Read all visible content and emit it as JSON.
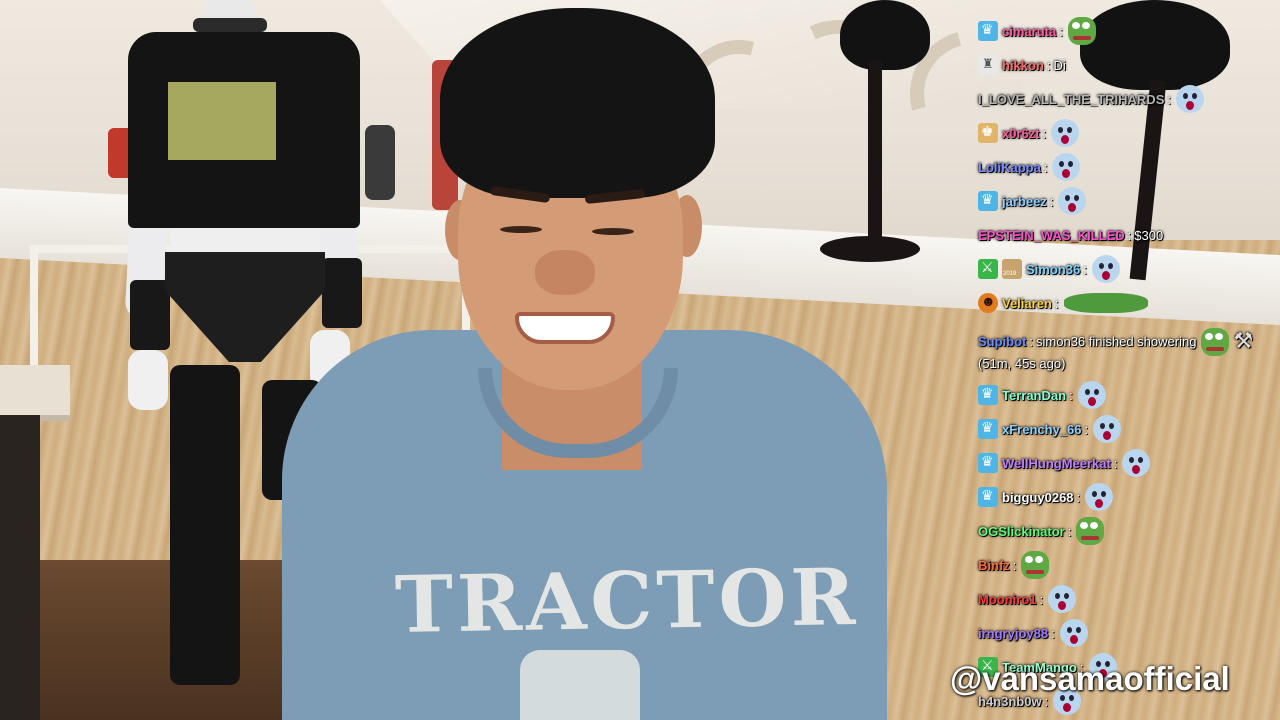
{
  "stream": {
    "watermark": "@vansamaofficial",
    "shirt_text": "TRACTOR"
  },
  "chat": {
    "messages": [
      {
        "user": "cimaruta",
        "color": "#ff5fa2",
        "badges": [
          "sub"
        ],
        "text": "",
        "emotes": [
          "pepe"
        ]
      },
      {
        "user": "hikkon",
        "color": "#ff6b6b",
        "badges": [
          "prime"
        ],
        "text": "Di",
        "emotes": []
      },
      {
        "user": "I_LOVE_ALL_THE_TRIHARDS",
        "color": "#b5b5b5",
        "badges": [],
        "text": "",
        "emotes": [
          "wow"
        ]
      },
      {
        "user": "x0r6zt",
        "color": "#ff5fa2",
        "badges": [
          "gift"
        ],
        "text": "",
        "emotes": [
          "wow"
        ]
      },
      {
        "user": "LoliKappa",
        "color": "#7b8cff",
        "badges": [],
        "text": "",
        "emotes": [
          "wow"
        ]
      },
      {
        "user": "jarbeez",
        "color": "#8fd0ff",
        "badges": [
          "sub"
        ],
        "text": "",
        "emotes": [
          "wow"
        ]
      },
      {
        "user": "EPSTEIN_WAS_KILLED",
        "color": "#ff4fcf",
        "badges": [],
        "text": "$300",
        "emotes": [
          "face"
        ]
      },
      {
        "user": "Simon36",
        "color": "#7fd4ff",
        "badges": [
          "green",
          "year"
        ],
        "text": "",
        "emotes": [
          "wow"
        ]
      },
      {
        "user": "Veliaren",
        "color": "#ffd23f",
        "badges": [
          "orange"
        ],
        "text": "",
        "emotes": [
          "wide"
        ]
      },
      {
        "user": "Supibot",
        "color": "#6b8bff",
        "badges": [],
        "text": "simon36 finished showering",
        "text2": "(51m, 45s ago)",
        "emotes": [
          "pepe",
          "tool"
        ]
      },
      {
        "user": "TerranDan",
        "color": "#7fffd4",
        "badges": [
          "sub"
        ],
        "text": "",
        "emotes": [
          "wow"
        ]
      },
      {
        "user": "xFrenchy_66",
        "color": "#8fd0ff",
        "badges": [
          "sub"
        ],
        "text": "",
        "emotes": [
          "wow"
        ]
      },
      {
        "user": "WellHungMeerkat",
        "color": "#c080ff",
        "badges": [
          "sub"
        ],
        "text": "",
        "emotes": [
          "wow"
        ]
      },
      {
        "user": "bigguy0268",
        "color": "#ffffff",
        "badges": [
          "sub"
        ],
        "text": "",
        "emotes": [
          "wow"
        ]
      },
      {
        "user": "OGSlickinator",
        "color": "#5cff7a",
        "badges": [],
        "text": "",
        "emotes": [
          "pepe"
        ]
      },
      {
        "user": "Binfz",
        "color": "#ff6b3a",
        "badges": [],
        "text": "",
        "emotes": [
          "pepe"
        ]
      },
      {
        "user": "Mooniro1",
        "color": "#ff3a3a",
        "badges": [],
        "text": "",
        "emotes": [
          "wow"
        ]
      },
      {
        "user": "irngryjoy88",
        "color": "#a07bff",
        "badges": [],
        "text": "",
        "emotes": [
          "wow"
        ]
      },
      {
        "user": "TeamMango",
        "color": "#9affd0",
        "badges": [
          "green"
        ],
        "text": "",
        "emotes": [
          "wow"
        ]
      },
      {
        "user": "h4n3nb0w",
        "color": "#cfcfcf",
        "badges": [],
        "text": "",
        "emotes": [
          "wow"
        ]
      }
    ]
  }
}
